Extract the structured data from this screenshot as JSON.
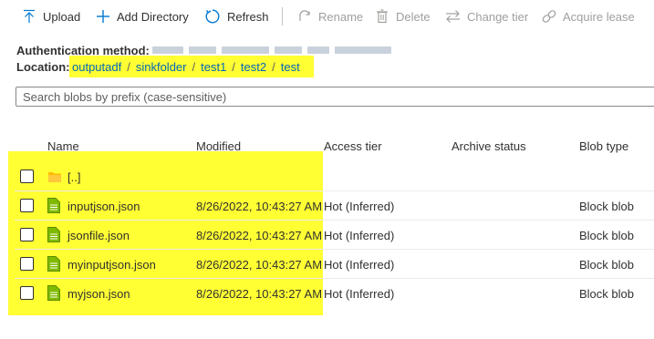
{
  "toolbar": {
    "upload": "Upload",
    "add_directory": "Add Directory",
    "refresh": "Refresh",
    "rename": "Rename",
    "delete": "Delete",
    "change_tier": "Change tier",
    "acquire_lease": "Acquire lease"
  },
  "auth": {
    "label": "Authentication method:"
  },
  "location": {
    "label": "Location:",
    "crumbs": [
      "outputadf",
      "sinkfolder",
      "test1",
      "test2",
      "test"
    ],
    "separator": "/"
  },
  "search": {
    "placeholder": "Search blobs by prefix (case-sensitive)"
  },
  "table": {
    "columns": [
      "Name",
      "Modified",
      "Access tier",
      "Archive status",
      "Blob type"
    ],
    "parent_row": {
      "name": "[..]",
      "icon": "folder-icon"
    },
    "rows": [
      {
        "name": "inputjson.json",
        "modified": "8/26/2022, 10:43:27 AM",
        "access_tier": "Hot (Inferred)",
        "archive_status": "",
        "blob_type": "Block blob",
        "icon": "file-icon"
      },
      {
        "name": "jsonfile.json",
        "modified": "8/26/2022, 10:43:27 AM",
        "access_tier": "Hot (Inferred)",
        "archive_status": "",
        "blob_type": "Block blob",
        "icon": "file-icon"
      },
      {
        "name": "myinputjson.json",
        "modified": "8/26/2022, 10:43:27 AM",
        "access_tier": "Hot (Inferred)",
        "archive_status": "",
        "blob_type": "Block blob",
        "icon": "file-icon"
      },
      {
        "name": "myjson.json",
        "modified": "8/26/2022, 10:43:27 AM",
        "access_tier": "Hot (Inferred)",
        "archive_status": "",
        "blob_type": "Block blob",
        "icon": "file-icon"
      }
    ]
  },
  "colors": {
    "accent": "#0078d4",
    "link": "#0067b8",
    "highlight": "#ffff33",
    "folder": "#ffb900",
    "file": "#7fba00",
    "disabled_text": "#a19f9d"
  }
}
